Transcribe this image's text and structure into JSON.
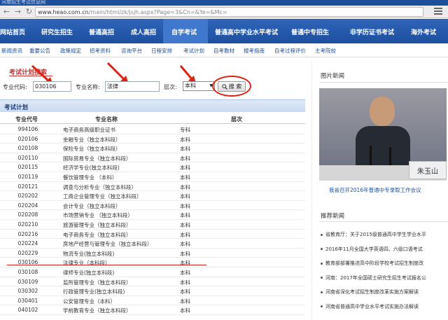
{
  "browser": {
    "banner_text": "河南招生考试信息网",
    "url_prefix": "www.heao.com.cn",
    "url_rest": "/main/html/zk/jsjh.aspx?Page=3&Cn=&Ye=&Mc="
  },
  "main_nav": [
    "网站首页",
    "研究生招生",
    "普通高招",
    "成人高招",
    "自学考试",
    "普通高中学业水平考试",
    "普通中专招生",
    "非学历证书考试",
    "海外考试"
  ],
  "sub_nav": [
    "新闻资讯",
    "重要公告",
    "政策规定",
    "招考资料",
    "咨询平台",
    "日程安排",
    "考试计划",
    "自考教材",
    "报考指南",
    "自考过程评价",
    "主考院校"
  ],
  "search": {
    "title": "考试计划搜索",
    "code_label": "专业代码:",
    "code_value": "030106",
    "name_label": "专业名称:",
    "name_value": "法律",
    "level_label": "层次:",
    "level_value": "本科",
    "button_label": "搜 索"
  },
  "plan": {
    "title": "考试计划",
    "columns": [
      "专业代号",
      "专业名称",
      "层次"
    ],
    "rows": [
      [
        "994106",
        "电子商务高级职业证书",
        "专科"
      ],
      [
        "020106",
        "金融专业（独立本科段）",
        "本科"
      ],
      [
        "020108",
        "保险专业（独立本科段）",
        "本科"
      ],
      [
        "020110",
        "国际贸易专业（独立本科段）",
        "本科"
      ],
      [
        "020115",
        "经济学专业(独立本科段)",
        "本科"
      ],
      [
        "020119",
        "餐饮管理专业 （本科）",
        "本科"
      ],
      [
        "020121",
        "调查与分析专业（独立本科段）",
        "本科"
      ],
      [
        "020202",
        "工商企业管理专业（独立本科段）",
        "本科"
      ],
      [
        "020204",
        "会计专业（独立本科段）",
        "本科"
      ],
      [
        "020208",
        "市场营销专业 （独立本科段）",
        "本科"
      ],
      [
        "020210",
        "旅游管理专业（独立本科段）",
        "本科"
      ],
      [
        "020216",
        "电子商务专业（独立本科段）",
        "本科"
      ],
      [
        "020224",
        "房地产经营与管理专业（独立本科段）",
        "本科"
      ],
      [
        "020229",
        "物流专业(独立本科段)",
        "本科"
      ],
      [
        "030106",
        "法律专业（本科段）",
        "本科"
      ],
      [
        "030108",
        "律师专业(独立本科段)",
        "本科"
      ],
      [
        "030109",
        "监所管理专业（独立本科段）",
        "本科"
      ],
      [
        "030302",
        "行政管理专业(独立本科段)",
        "本科"
      ],
      [
        "030401",
        "公安管理专业（本科）",
        "本科"
      ],
      [
        "040102",
        "学前教育专业（独立本科段）",
        "本科"
      ]
    ]
  },
  "right": {
    "photo_title": "图片新闻",
    "photo_namecard": "朱玉山",
    "photo_caption": "我省召开2016年普通中专录取工作会议",
    "news_title": "推荐新闻",
    "news": [
      "省教育厅：关于2015级普通高中学生学业水平",
      "2016年11月全国大学英语四、六级口语考试",
      "教育部部署推进高中阶段学校考试招生制度改",
      "河南：2017年全国硕士研究生招生考试报名公",
      "河南省深化考试招生制度改革实施方案解读",
      "河南省普通高中学业水平考试实施办法解读"
    ]
  }
}
